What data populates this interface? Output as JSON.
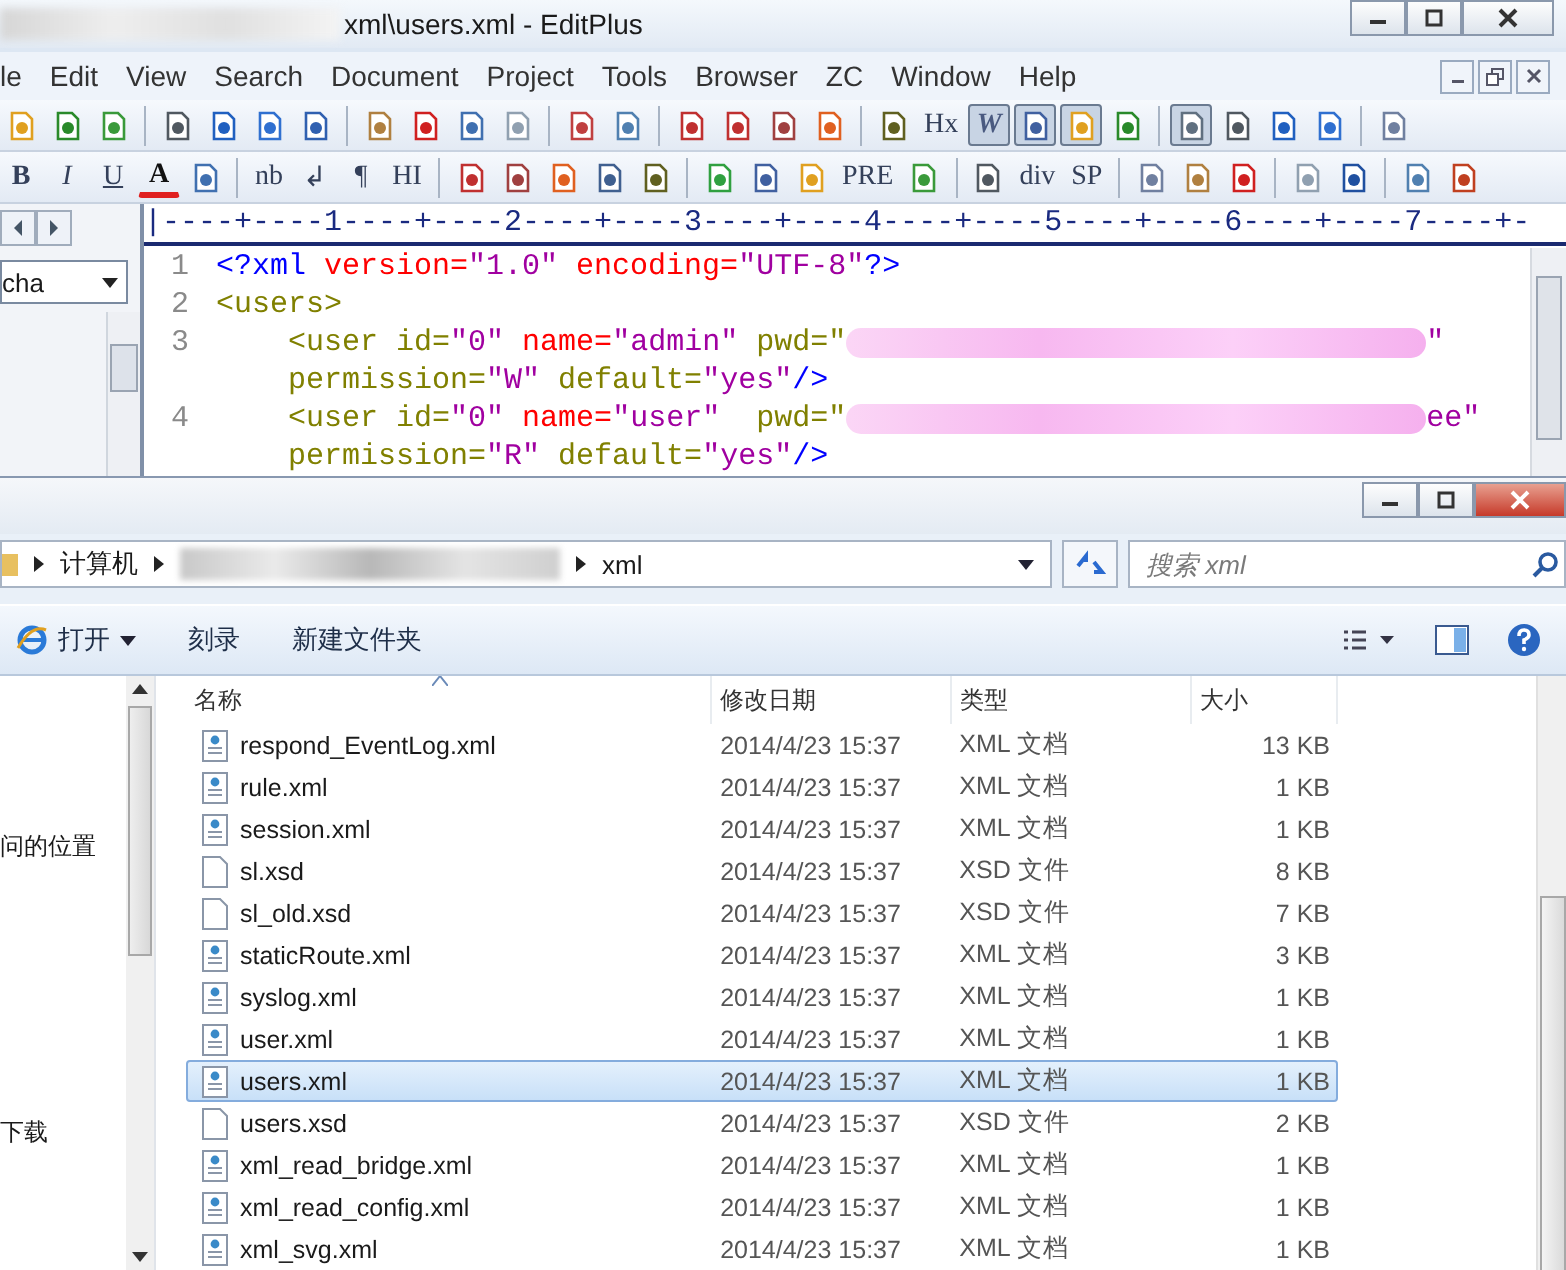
{
  "editplus": {
    "title": "xml\\users.xml - EditPlus",
    "menu": [
      "le",
      "Edit",
      "View",
      "Search",
      "Document",
      "Project",
      "Tools",
      "Browser",
      "ZC",
      "Window",
      "Help"
    ],
    "toolbar_1": [
      {
        "kind": "icon",
        "pressed": false
      },
      {
        "kind": "icon",
        "pressed": false
      },
      {
        "kind": "icon",
        "pressed": false
      },
      {
        "kind": "sep"
      },
      {
        "kind": "icon",
        "pressed": false
      },
      {
        "kind": "icon",
        "pressed": false
      },
      {
        "kind": "icon",
        "pressed": false
      },
      {
        "kind": "icon",
        "pressed": false
      },
      {
        "kind": "sep"
      },
      {
        "kind": "icon",
        "pressed": false
      },
      {
        "kind": "icon",
        "pressed": false
      },
      {
        "kind": "icon",
        "pressed": false
      },
      {
        "kind": "icon",
        "pressed": false
      },
      {
        "kind": "sep"
      },
      {
        "kind": "icon",
        "pressed": false
      },
      {
        "kind": "icon",
        "pressed": false
      },
      {
        "kind": "sep"
      },
      {
        "kind": "icon",
        "pressed": false
      },
      {
        "kind": "icon",
        "pressed": false
      },
      {
        "kind": "icon",
        "pressed": false
      },
      {
        "kind": "icon",
        "pressed": false
      },
      {
        "kind": "sep"
      },
      {
        "kind": "icon",
        "pressed": false
      },
      {
        "kind": "text",
        "label": "Hx",
        "pressed": false
      },
      {
        "kind": "text",
        "label": "W",
        "pressed": true
      },
      {
        "kind": "icon",
        "pressed": true
      },
      {
        "kind": "icon",
        "pressed": true
      },
      {
        "kind": "icon",
        "pressed": false
      },
      {
        "kind": "sep"
      },
      {
        "kind": "icon",
        "pressed": true
      },
      {
        "kind": "icon",
        "pressed": false
      },
      {
        "kind": "icon",
        "pressed": false
      },
      {
        "kind": "icon",
        "pressed": false
      },
      {
        "kind": "sep"
      },
      {
        "kind": "icon",
        "pressed": false
      }
    ],
    "toolbar_2": [
      {
        "kind": "text",
        "label": "B",
        "pressed": false
      },
      {
        "kind": "text",
        "label": "I",
        "pressed": false
      },
      {
        "kind": "text",
        "label": "U",
        "pressed": false
      },
      {
        "kind": "text",
        "label": "A",
        "pressed": false
      },
      {
        "kind": "icon",
        "pressed": false
      },
      {
        "kind": "sep"
      },
      {
        "kind": "text",
        "label": "nb",
        "pressed": false
      },
      {
        "kind": "text",
        "label": "↲",
        "pressed": false
      },
      {
        "kind": "text",
        "label": "¶",
        "pressed": false
      },
      {
        "kind": "text",
        "label": "HI",
        "pressed": false
      },
      {
        "kind": "sep"
      },
      {
        "kind": "icon",
        "pressed": false
      },
      {
        "kind": "icon",
        "pressed": false
      },
      {
        "kind": "icon",
        "pressed": false
      },
      {
        "kind": "icon",
        "pressed": false
      },
      {
        "kind": "icon",
        "pressed": false
      },
      {
        "kind": "sep"
      },
      {
        "kind": "icon",
        "pressed": false
      },
      {
        "kind": "icon",
        "pressed": false
      },
      {
        "kind": "icon",
        "pressed": false
      },
      {
        "kind": "text",
        "label": "PRE",
        "pressed": false
      },
      {
        "kind": "icon",
        "pressed": false
      },
      {
        "kind": "sep"
      },
      {
        "kind": "icon",
        "pressed": false
      },
      {
        "kind": "text",
        "label": "div",
        "pressed": false
      },
      {
        "kind": "text",
        "label": "SP",
        "pressed": false
      },
      {
        "kind": "sep"
      },
      {
        "kind": "icon",
        "pressed": false
      },
      {
        "kind": "icon",
        "pressed": false
      },
      {
        "kind": "icon",
        "pressed": false
      },
      {
        "kind": "sep"
      },
      {
        "kind": "icon",
        "pressed": false
      },
      {
        "kind": "icon",
        "pressed": false
      },
      {
        "kind": "sep"
      },
      {
        "kind": "icon",
        "pressed": false
      },
      {
        "kind": "icon",
        "pressed": false
      }
    ],
    "side_dropdown": "cha",
    "ruler": "|----+----1----+----2----+----3----+----4----+----5----+----6----+----7----+-",
    "lines": [
      {
        "number": "1",
        "segments": [
          {
            "kind": "text",
            "text": "<?xml ",
            "color": "#0000ff"
          },
          {
            "kind": "text",
            "text": "version=",
            "color": "#ff0000"
          },
          {
            "kind": "text",
            "text": "\"1.0\" ",
            "color": "#a000a0"
          },
          {
            "kind": "text",
            "text": "encoding=",
            "color": "#ff0000"
          },
          {
            "kind": "text",
            "text": "\"UTF-8\"",
            "color": "#a000a0"
          },
          {
            "kind": "text",
            "text": "?>",
            "color": "#0000ff"
          }
        ]
      },
      {
        "number": "2",
        "segments": [
          {
            "kind": "text",
            "text": "<users>",
            "color": "#808000"
          }
        ]
      },
      {
        "number": "3",
        "segments": [
          {
            "kind": "text",
            "text": "    <user ",
            "color": "#808000"
          },
          {
            "kind": "text",
            "text": "id=",
            "color": "#808000"
          },
          {
            "kind": "text",
            "text": "\"0\" ",
            "color": "#a000a0"
          },
          {
            "kind": "text",
            "text": "name=",
            "color": "#ff0000"
          },
          {
            "kind": "text",
            "text": "\"admin\" ",
            "color": "#a000a0"
          },
          {
            "kind": "text",
            "text": "pwd=\"",
            "color": "#808000"
          },
          {
            "kind": "redacted"
          },
          {
            "kind": "text",
            "text": "\"",
            "color": "#a000a0"
          }
        ]
      },
      {
        "segments": [
          {
            "kind": "text",
            "text": "    permission=",
            "color": "#808000"
          },
          {
            "kind": "text",
            "text": "\"W\" ",
            "color": "#a000a0"
          },
          {
            "kind": "text",
            "text": "default=",
            "color": "#808000"
          },
          {
            "kind": "text",
            "text": "\"yes\"",
            "color": "#a000a0"
          },
          {
            "kind": "text",
            "text": "/>",
            "color": "#0000ff"
          }
        ]
      },
      {
        "number": "4",
        "segments": [
          {
            "kind": "text",
            "text": "    <user ",
            "color": "#808000"
          },
          {
            "kind": "text",
            "text": "id=",
            "color": "#808000"
          },
          {
            "kind": "text",
            "text": "\"0\" ",
            "color": "#a000a0"
          },
          {
            "kind": "text",
            "text": "name=",
            "color": "#ff0000"
          },
          {
            "kind": "text",
            "text": "\"user\"  ",
            "color": "#a000a0"
          },
          {
            "kind": "text",
            "text": "pwd=\"",
            "color": "#808000"
          },
          {
            "kind": "redacted"
          },
          {
            "kind": "text",
            "text": "ee\"",
            "color": "#a000a0"
          }
        ]
      },
      {
        "segments": [
          {
            "kind": "text",
            "text": "    permission=",
            "color": "#808000"
          },
          {
            "kind": "text",
            "text": "\"R\" ",
            "color": "#a000a0"
          },
          {
            "kind": "text",
            "text": "default=",
            "color": "#808000"
          },
          {
            "kind": "text",
            "text": "\"yes\"",
            "color": "#a000a0"
          },
          {
            "kind": "text",
            "text": "/>",
            "color": "#0000ff"
          }
        ]
      }
    ]
  },
  "explorer": {
    "breadcrumbs": [
      {
        "kind": "text",
        "label": "计算机"
      },
      {
        "kind": "redacted"
      },
      {
        "kind": "text",
        "label": "xml"
      }
    ],
    "search": {
      "placeholder": "搜索 xml"
    },
    "commands": [
      {
        "kind": "open",
        "label": "打开"
      },
      {
        "kind": "plain",
        "label": "刻录"
      },
      {
        "kind": "plain",
        "label": "新建文件夹"
      }
    ],
    "nav_items": [
      "问的位置",
      "下载"
    ],
    "columns": [
      "名称",
      "修改日期",
      "类型",
      "大小"
    ],
    "files": [
      {
        "name": "respond_EventLog.xml",
        "date": "2014/4/23 15:37",
        "type": "XML 文档",
        "size": "13 KB",
        "kind": "xml",
        "selected": false
      },
      {
        "name": "rule.xml",
        "date": "2014/4/23 15:37",
        "type": "XML 文档",
        "size": "1 KB",
        "kind": "xml",
        "selected": false
      },
      {
        "name": "session.xml",
        "date": "2014/4/23 15:37",
        "type": "XML 文档",
        "size": "1 KB",
        "kind": "xml",
        "selected": false
      },
      {
        "name": "sl.xsd",
        "date": "2014/4/23 15:37",
        "type": "XSD 文件",
        "size": "8 KB",
        "kind": "xsd",
        "selected": false
      },
      {
        "name": "sl_old.xsd",
        "date": "2014/4/23 15:37",
        "type": "XSD 文件",
        "size": "7 KB",
        "kind": "xsd",
        "selected": false
      },
      {
        "name": "staticRoute.xml",
        "date": "2014/4/23 15:37",
        "type": "XML 文档",
        "size": "3 KB",
        "kind": "xml",
        "selected": false
      },
      {
        "name": "syslog.xml",
        "date": "2014/4/23 15:37",
        "type": "XML 文档",
        "size": "1 KB",
        "kind": "xml",
        "selected": false
      },
      {
        "name": "user.xml",
        "date": "2014/4/23 15:37",
        "type": "XML 文档",
        "size": "1 KB",
        "kind": "xml",
        "selected": false
      },
      {
        "name": "users.xml",
        "date": "2014/4/23 15:37",
        "type": "XML 文档",
        "size": "1 KB",
        "kind": "xml",
        "selected": true
      },
      {
        "name": "users.xsd",
        "date": "2014/4/23 15:37",
        "type": "XSD 文件",
        "size": "2 KB",
        "kind": "xsd",
        "selected": false
      },
      {
        "name": "xml_read_bridge.xml",
        "date": "2014/4/23 15:37",
        "type": "XML 文档",
        "size": "1 KB",
        "kind": "xml",
        "selected": false
      },
      {
        "name": "xml_read_config.xml",
        "date": "2014/4/23 15:37",
        "type": "XML 文档",
        "size": "1 KB",
        "kind": "xml",
        "selected": false
      },
      {
        "name": "xml_svg.xml",
        "date": "2014/4/23 15:37",
        "type": "XML 文档",
        "size": "1 KB",
        "kind": "xml",
        "selected": false
      }
    ]
  }
}
